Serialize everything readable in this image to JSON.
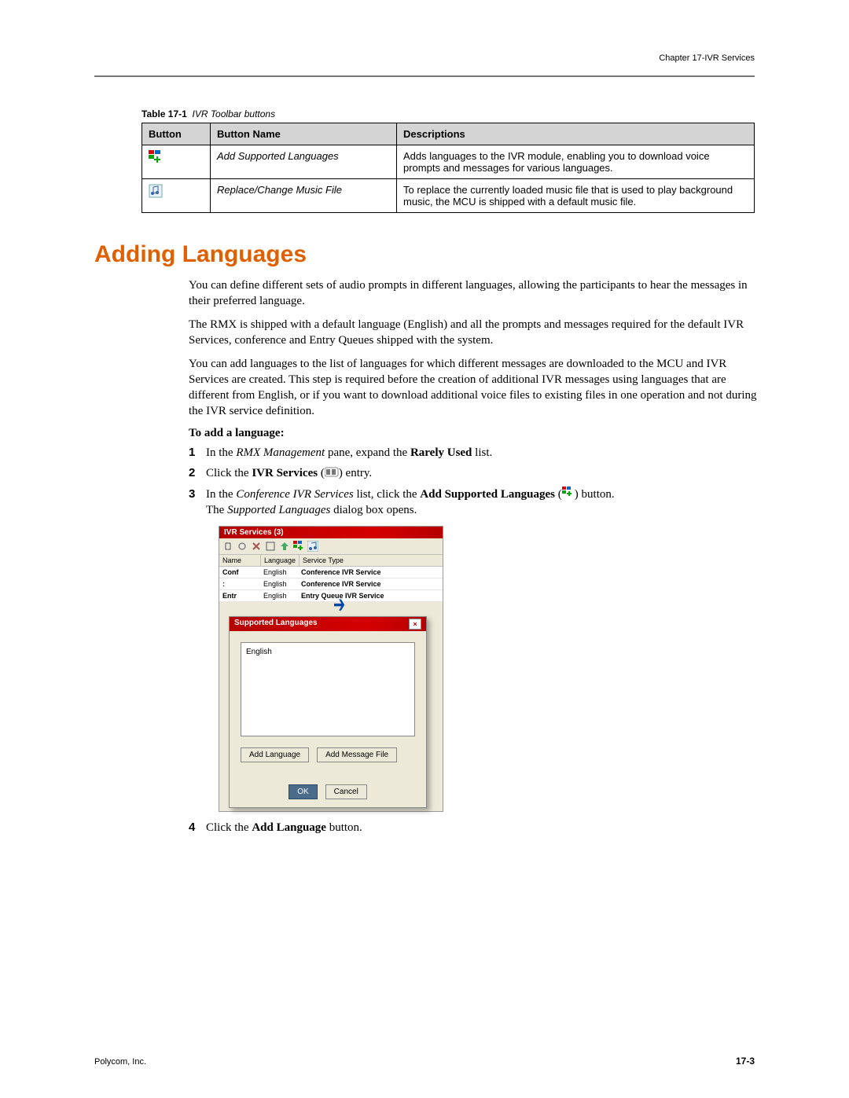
{
  "header": {
    "chapter": "Chapter 17-IVR Services"
  },
  "table": {
    "caption_label": "Table 17-1",
    "caption_text": "IVR Toolbar buttons",
    "headers": {
      "button": "Button",
      "name": "Button Name",
      "desc": "Descriptions"
    },
    "rows": [
      {
        "name": "Add Supported Languages",
        "desc": "Adds languages to the IVR module, enabling you to download voice prompts and messages for various languages."
      },
      {
        "name": "Replace/Change Music File",
        "desc": "To replace the currently loaded music file that is used to play background music, the MCU is shipped with a default music file."
      }
    ]
  },
  "section": {
    "title": "Adding Languages",
    "p1": "You can define different sets of audio prompts in different languages, allowing the participants to hear the messages in their preferred language.",
    "p2": "The RMX is shipped with a default language (English) and all the prompts and messages required for the default IVR Services, conference and Entry Queues shipped with the system.",
    "p3": "You can add languages to the list of languages for which different messages are downloaded to the MCU and IVR Services are created. This step is required before the creation of additional IVR messages using languages that are different from English, or if you want to download additional voice files to existing files in one operation and not during the IVR service definition.",
    "steps_title": "To add a language:",
    "steps": [
      {
        "num": "1",
        "pre": "In the ",
        "ital1": "RMX Management",
        "mid": " pane, expand the ",
        "bold1": "Rarely Used",
        "post": " list."
      },
      {
        "num": "2",
        "pre": "Click the ",
        "bold1": "IVR Services",
        "post": " ( ) entry.",
        "has_icon": true
      },
      {
        "num": "3",
        "pre": "In the ",
        "ital1": "Conference IVR Services",
        "mid": " list, click the ",
        "bold1": "Add Supported Languages",
        "post": " ( ) button.",
        "has_icon": true,
        "line2_pre": "The ",
        "line2_ital": "Supported Languages",
        "line2_post": " dialog box opens."
      },
      {
        "num": "4",
        "pre": "Click the ",
        "bold1": "Add Language",
        "post": " button."
      }
    ]
  },
  "app": {
    "title": "IVR Services (3)",
    "cols": {
      "name": "Name",
      "lang": "Language",
      "type": "Service Type"
    },
    "rows": [
      {
        "name": "Conf",
        "lang": "English",
        "type": "Conference IVR Service"
      },
      {
        "name": ":",
        "lang": "English",
        "type": "Conference IVR Service"
      },
      {
        "name": "Entr",
        "lang": "English",
        "type": "Entry Queue IVR Service"
      }
    ]
  },
  "dialog": {
    "title": "Supported Languages",
    "list_item": "English",
    "buttons": {
      "add_lang": "Add Language",
      "add_msg": "Add Message File",
      "ok": "OK",
      "cancel": "Cancel"
    }
  },
  "footer": {
    "company": "Polycom, Inc.",
    "page": "17-3"
  }
}
